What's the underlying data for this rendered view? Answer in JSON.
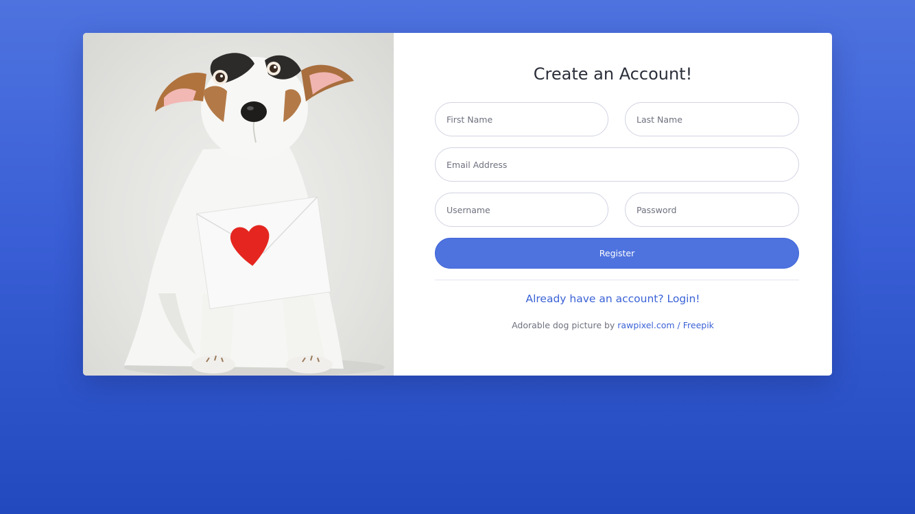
{
  "form": {
    "title": "Create an Account!",
    "first_name_placeholder": "First Name",
    "last_name_placeholder": "Last Name",
    "email_placeholder": "Email Address",
    "username_placeholder": "Username",
    "password_placeholder": "Password",
    "register_label": "Register",
    "login_link": "Already have an account? Login!"
  },
  "credit": {
    "prefix": "Adorable dog picture by ",
    "link": "rawpixel.com / Freepik"
  },
  "image": {
    "subject": "puppy-holding-heart-envelope"
  },
  "colors": {
    "primary": "#4e73df",
    "link": "#3a62d6",
    "background_top": "#4e73df",
    "background_bottom": "#224abe"
  }
}
